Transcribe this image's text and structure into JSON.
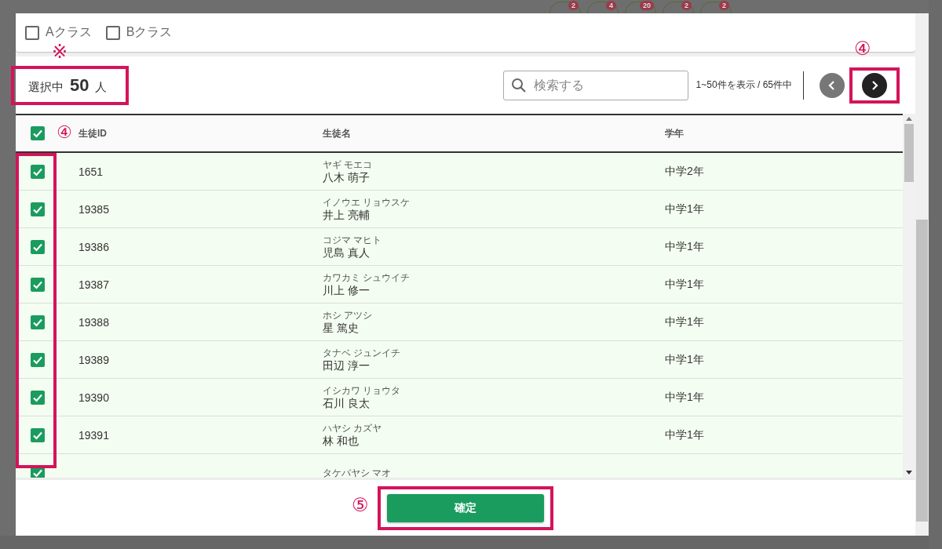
{
  "background_badges": [
    "2",
    "4",
    "20",
    "2",
    "2"
  ],
  "class_filters": [
    {
      "label": "Aクラス",
      "checked": false
    },
    {
      "label": "Bクラス",
      "checked": false
    }
  ],
  "selection": {
    "label": "選択中",
    "count": "50",
    "unit": "人",
    "annotation": "※"
  },
  "search": {
    "placeholder": "検索する"
  },
  "pagination": {
    "range": "1~50件を表示 / 65件中",
    "prev_disabled": true,
    "annotation": "④"
  },
  "table": {
    "select_all_checked": true,
    "annotation": "④",
    "columns": [
      "生徒ID",
      "生徒名",
      "学年"
    ],
    "rows": [
      {
        "id": "1651",
        "kana": "ヤギ モエコ",
        "name": "八木 萌子",
        "grade": "中学2年",
        "selected": true
      },
      {
        "id": "19385",
        "kana": "イノウエ リョウスケ",
        "name": "井上 亮輔",
        "grade": "中学1年",
        "selected": true
      },
      {
        "id": "19386",
        "kana": "コジマ マヒト",
        "name": "児島 真人",
        "grade": "中学1年",
        "selected": true
      },
      {
        "id": "19387",
        "kana": "カワカミ シュウイチ",
        "name": "川上 修一",
        "grade": "中学1年",
        "selected": true
      },
      {
        "id": "19388",
        "kana": "ホシ アツシ",
        "name": "星 篤史",
        "grade": "中学1年",
        "selected": true
      },
      {
        "id": "19389",
        "kana": "タナベ ジュンイチ",
        "name": "田辺 淳一",
        "grade": "中学1年",
        "selected": true
      },
      {
        "id": "19390",
        "kana": "イシカワ リョウタ",
        "name": "石川 良太",
        "grade": "中学1年",
        "selected": true
      },
      {
        "id": "19391",
        "kana": "ハヤシ カズヤ",
        "name": "林 和也",
        "grade": "中学1年",
        "selected": true
      },
      {
        "kana": "タケバヤシ マオ",
        "selected": true
      }
    ]
  },
  "confirm": {
    "label": "確定",
    "annotation": "⑤"
  }
}
